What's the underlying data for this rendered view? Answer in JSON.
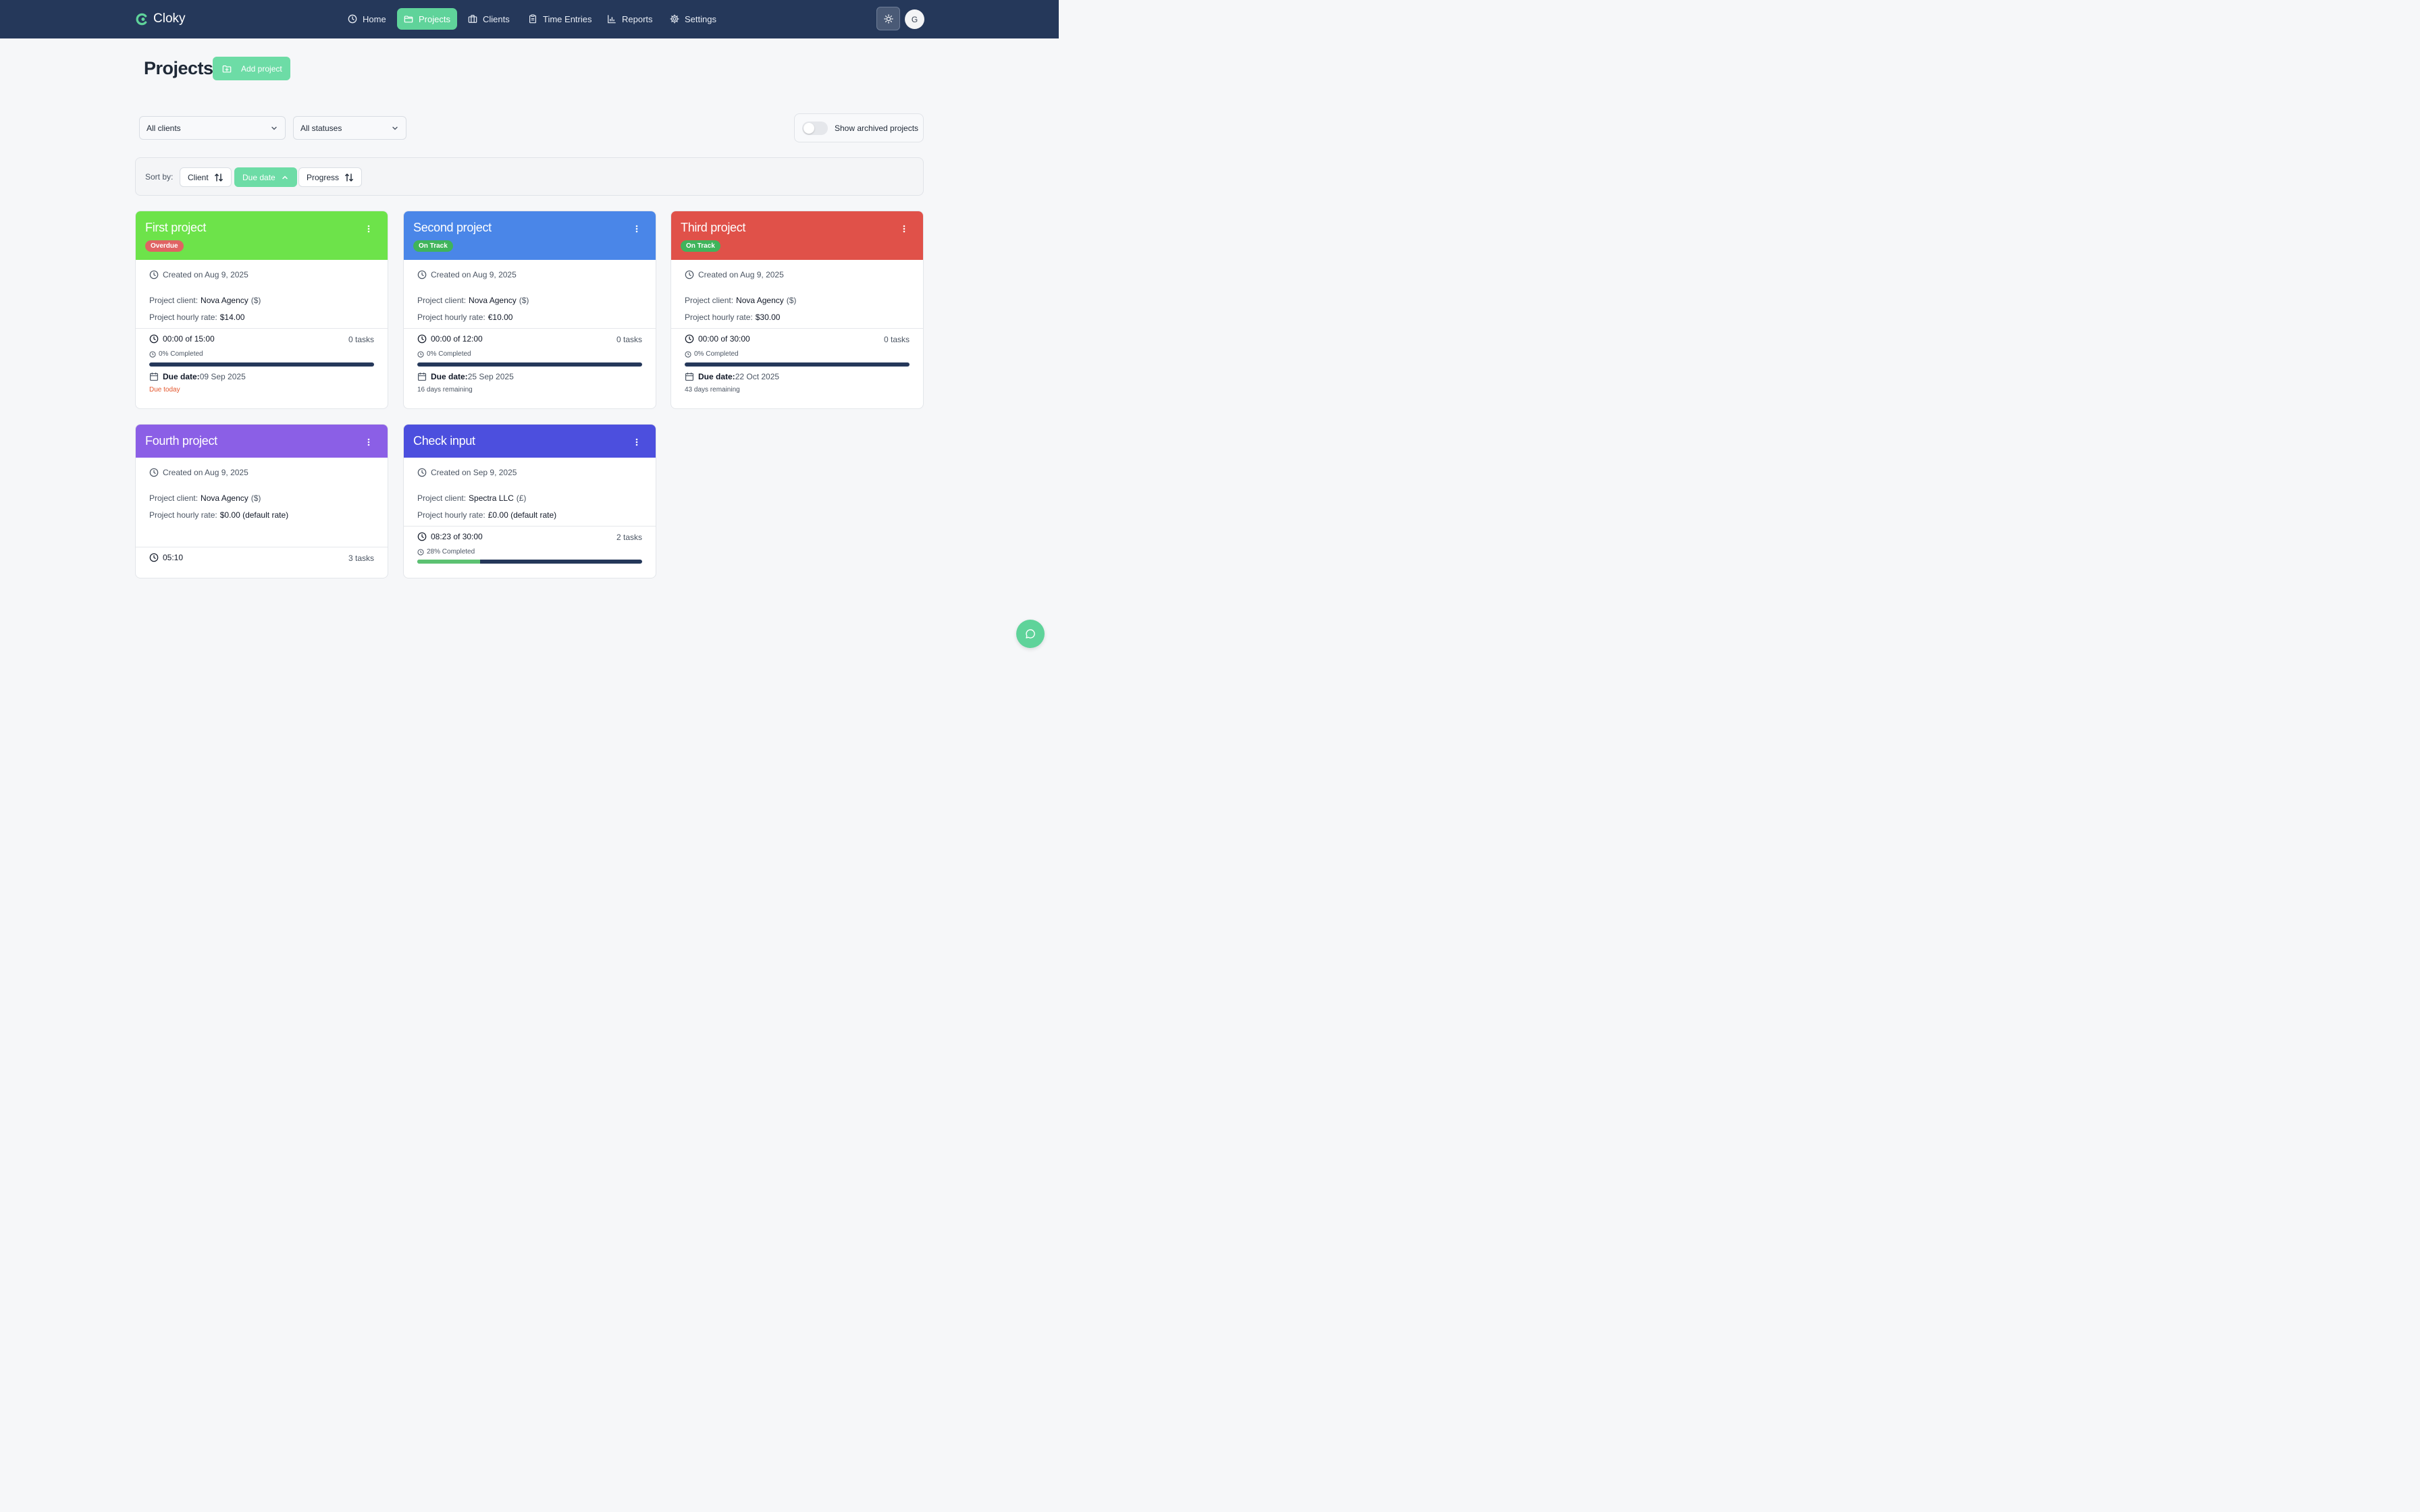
{
  "app": {
    "name": "Cloky"
  },
  "nav": {
    "home": "Home",
    "projects": "Projects",
    "clients": "Clients",
    "time_entries": "Time Entries",
    "reports": "Reports",
    "settings": "Settings"
  },
  "user": {
    "initial": "G"
  },
  "page": {
    "title": "Projects",
    "add_label": "Add project"
  },
  "filters": {
    "client_value": "All clients",
    "status_value": "All statuses",
    "archived_label": "Show archived projects",
    "archived_on": false
  },
  "sort": {
    "label": "Sort by:",
    "client": "Client",
    "due_date": "Due date",
    "progress": "Progress",
    "active": "Due date"
  },
  "projects": [
    {
      "name": "First project",
      "color": "#6de34a",
      "status": "Overdue",
      "created": "Created on Aug 9, 2025",
      "client_label": "Project client:",
      "client": "Nova Agency",
      "currency": "($)",
      "rate_label": "Project hourly rate:",
      "rate": "$14.00",
      "time": "00:00 of 15:00",
      "tasks": "0 tasks",
      "completed": "0% Completed",
      "progress": 0,
      "due_label": "Due date:",
      "due_date": "09 Sep 2025",
      "due_note": "Due today"
    },
    {
      "name": "Second project",
      "color": "#4a86e8",
      "status": "On Track",
      "created": "Created on Aug 9, 2025",
      "client_label": "Project client:",
      "client": "Nova Agency",
      "currency": "($)",
      "rate_label": "Project hourly rate:",
      "rate": "€10.00",
      "time": "00:00 of 12:00",
      "tasks": "0 tasks",
      "completed": "0% Completed",
      "progress": 0,
      "due_label": "Due date:",
      "due_date": "25 Sep 2025",
      "due_note": "16 days remaining"
    },
    {
      "name": "Third project",
      "color": "#e05149",
      "status": "On Track",
      "created": "Created on Aug 9, 2025",
      "client_label": "Project client:",
      "client": "Nova Agency",
      "currency": "($)",
      "rate_label": "Project hourly rate:",
      "rate": "$30.00",
      "time": "00:00 of 30:00",
      "tasks": "0 tasks",
      "completed": "0% Completed",
      "progress": 0,
      "due_label": "Due date:",
      "due_date": "22 Oct 2025",
      "due_note": "43 days remaining"
    },
    {
      "name": "Fourth project",
      "color": "#8b5fe6",
      "created": "Created on Aug 9, 2025",
      "client_label": "Project client:",
      "client": "Nova Agency",
      "currency": "($)",
      "rate_label": "Project hourly rate:",
      "rate": "$0.00 (default rate)",
      "time": "05:10",
      "tasks": "3 tasks"
    },
    {
      "name": "Check input",
      "color": "#4c4fde",
      "created": "Created on Sep 9, 2025",
      "client_label": "Project client:",
      "client": "Spectra LLC",
      "currency": "(£)",
      "rate_label": "Project hourly rate:",
      "rate": "£0.00 (default rate)",
      "time": "08:23 of 30:00",
      "tasks": "2 tasks",
      "completed": "28% Completed",
      "progress": 0.28
    }
  ],
  "colors": {
    "nav_bg": "#25385a",
    "accent": "#5fd39a",
    "progress_track": "#25385a",
    "progress_fill": "#5cc272"
  },
  "icons": {
    "logo": "cloky-logo-icon",
    "home": "clock-icon",
    "projects": "folder-icon",
    "clients": "briefcase-icon",
    "time_entries": "clipboard-icon",
    "reports": "bar-chart-icon",
    "settings": "gear-icon",
    "theme": "sun-icon",
    "add": "folder-plus-icon",
    "chat": "chat-bubble-icon"
  }
}
